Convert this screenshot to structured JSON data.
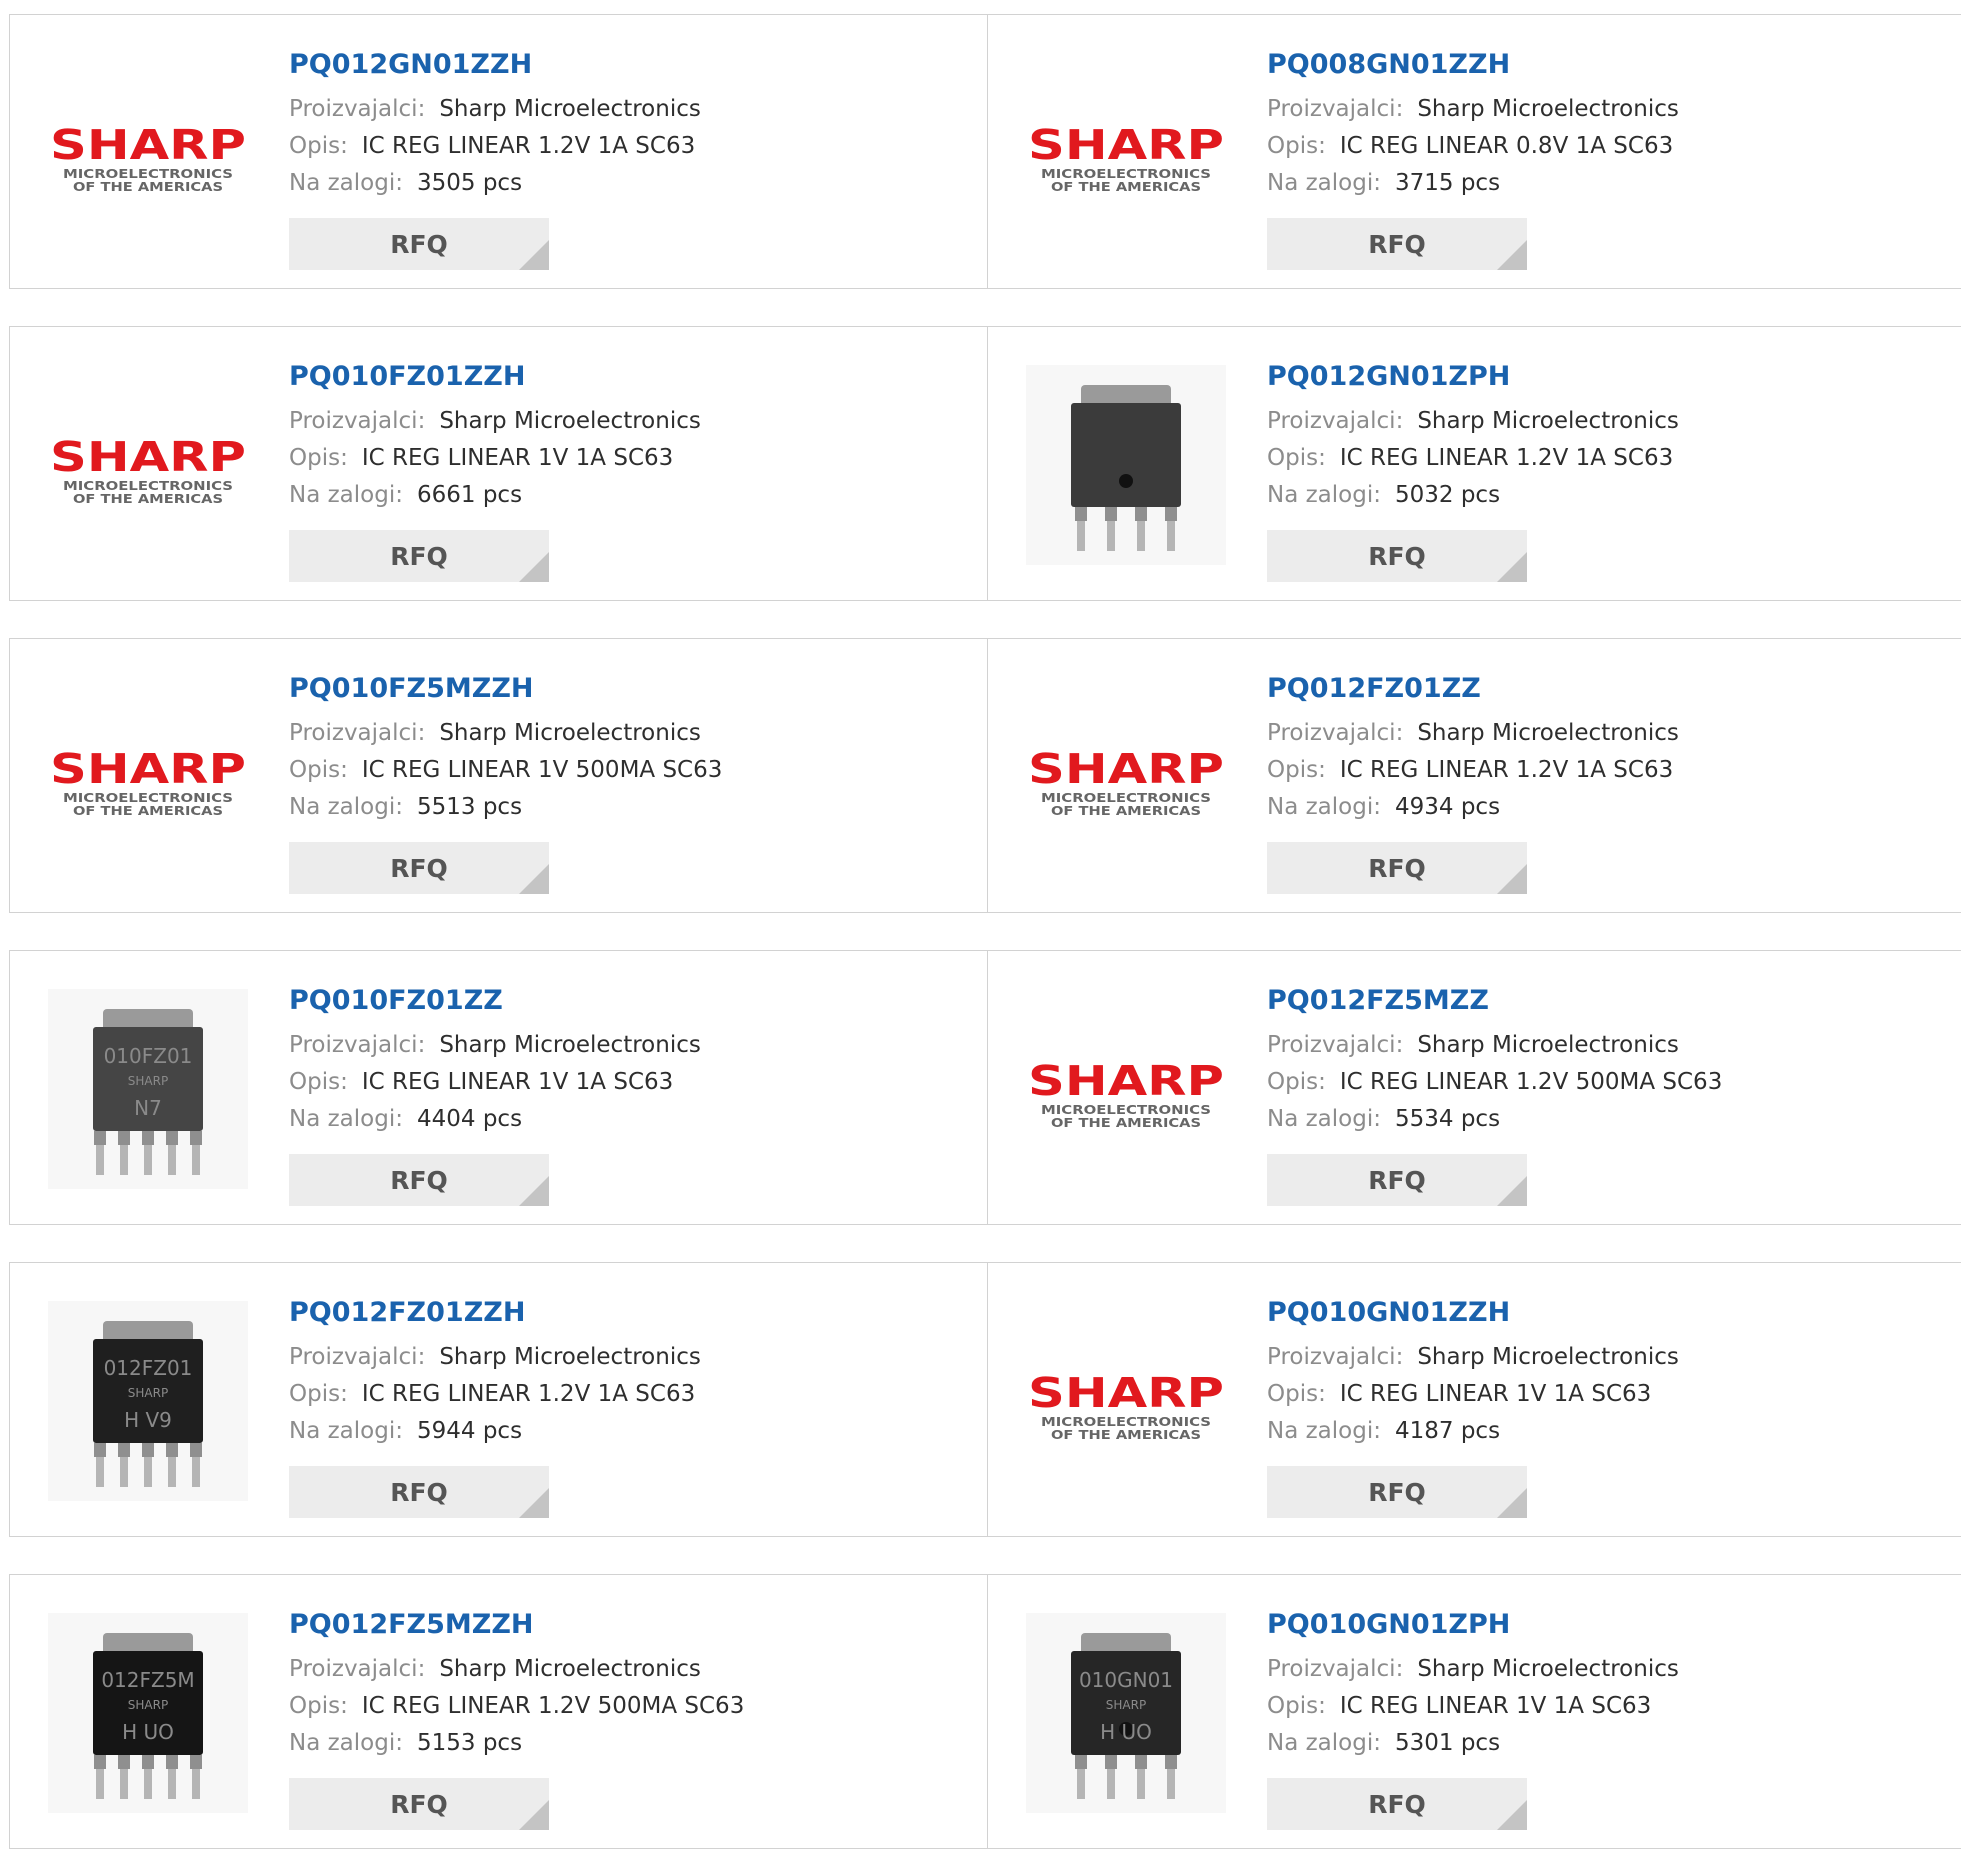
{
  "labels": {
    "manufacturer": "Proizvajalci:",
    "description": "Opis:",
    "stock": "Na zalogi:",
    "rfq": "RFQ"
  },
  "logo": {
    "brand": "SHARP",
    "line1": "MICROELECTRONICS",
    "line2": "OF THE AMERICAS",
    "brand_color": "#e1191e"
  },
  "products": [
    {
      "part": "PQ012GN01ZZH",
      "manufacturer": "Sharp Microelectronics",
      "description": "IC REG LINEAR 1.2V 1A SC63",
      "stock": "3505 pcs",
      "image": "logo"
    },
    {
      "part": "PQ008GN01ZZH",
      "manufacturer": "Sharp Microelectronics",
      "description": "IC REG LINEAR 0.8V 1A SC63",
      "stock": "3715 pcs",
      "image": "logo"
    },
    {
      "part": "PQ010FZ01ZZH",
      "manufacturer": "Sharp Microelectronics",
      "description": "IC REG LINEAR 1V 1A SC63",
      "stock": "6661 pcs",
      "image": "logo"
    },
    {
      "part": "PQ012GN01ZPH",
      "manufacturer": "Sharp Microelectronics",
      "description": "IC REG LINEAR 1.2V 1A SC63",
      "stock": "5032 pcs",
      "image": "chip",
      "chip": {
        "body": "#3b3b3b",
        "marking": [],
        "dot": true,
        "leads": 4
      }
    },
    {
      "part": "PQ010FZ5MZZH",
      "manufacturer": "Sharp Microelectronics",
      "description": "IC REG LINEAR 1V 500MA SC63",
      "stock": "5513 pcs",
      "image": "logo"
    },
    {
      "part": "PQ012FZ01ZZ",
      "manufacturer": "Sharp Microelectronics",
      "description": "IC REG LINEAR 1.2V 1A SC63",
      "stock": "4934 pcs",
      "image": "logo"
    },
    {
      "part": "PQ010FZ01ZZ",
      "manufacturer": "Sharp Microelectronics",
      "description": "IC REG LINEAR 1V 1A SC63",
      "stock": "4404 pcs",
      "image": "chip",
      "chip": {
        "body": "#454545",
        "marking": [
          "010FZ01",
          "SHARP",
          "N7"
        ],
        "dot": false,
        "leads": 5
      }
    },
    {
      "part": "PQ012FZ5MZZ",
      "manufacturer": "Sharp Microelectronics",
      "description": "IC REG LINEAR 1.2V 500MA SC63",
      "stock": "5534 pcs",
      "image": "logo"
    },
    {
      "part": "PQ012FZ01ZZH",
      "manufacturer": "Sharp Microelectronics",
      "description": "IC REG LINEAR 1.2V 1A SC63",
      "stock": "5944 pcs",
      "image": "chip",
      "chip": {
        "body": "#1f1f1f",
        "marking": [
          "012FZ01",
          "SHARP",
          "H V9"
        ],
        "dot": false,
        "leads": 5
      }
    },
    {
      "part": "PQ010GN01ZZH",
      "manufacturer": "Sharp Microelectronics",
      "description": "IC REG LINEAR 1V 1A SC63",
      "stock": "4187 pcs",
      "image": "logo"
    },
    {
      "part": "PQ012FZ5MZZH",
      "manufacturer": "Sharp Microelectronics",
      "description": "IC REG LINEAR 1.2V 500MA SC63",
      "stock": "5153 pcs",
      "image": "chip",
      "chip": {
        "body": "#151515",
        "marking": [
          "012FZ5M",
          "SHARP",
          "H UO"
        ],
        "dot": false,
        "leads": 5
      }
    },
    {
      "part": "PQ010GN01ZPH",
      "manufacturer": "Sharp Microelectronics",
      "description": "IC REG LINEAR 1V 1A SC63",
      "stock": "5301 pcs",
      "image": "chip",
      "chip": {
        "body": "#262626",
        "marking": [
          "010GN01",
          "SHARP",
          "H UO"
        ],
        "dot": true,
        "leads": 4
      }
    }
  ]
}
